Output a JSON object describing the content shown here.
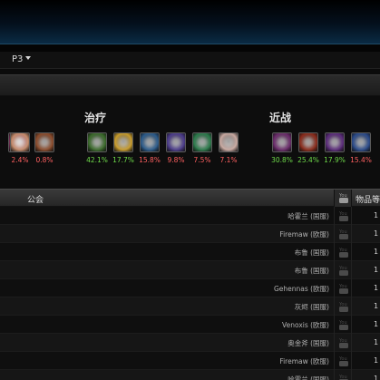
{
  "phase": {
    "label": "P3"
  },
  "groups": [
    {
      "title": "",
      "specs": [
        {
          "icon": "spec-icon-1",
          "pct": "",
          "color": "#ff6060",
          "bg": "#7a2a55"
        },
        {
          "icon": "spec-icon-2",
          "pct": "2.4%",
          "color": "#ff6060",
          "bg": "#c48a6a"
        },
        {
          "icon": "spec-icon-3",
          "pct": "0.8%",
          "color": "#ff6060",
          "bg": "#8a4a2a"
        }
      ]
    },
    {
      "title": "治疗",
      "specs": [
        {
          "icon": "nature-heal-icon",
          "pct": "42.1%",
          "color": "#6fdc4a",
          "bg": "#3a6a2a"
        },
        {
          "icon": "holy-light-icon",
          "pct": "17.7%",
          "color": "#6fdc4a",
          "bg": "#c69a2a"
        },
        {
          "icon": "water-shield-icon",
          "pct": "15.8%",
          "color": "#ff6060",
          "bg": "#2a5a8a"
        },
        {
          "icon": "shadow-mend-icon",
          "pct": "9.8%",
          "color": "#ff6060",
          "bg": "#4a3a8a"
        },
        {
          "icon": "leaf-heal-icon",
          "pct": "7.5%",
          "color": "#ff6060",
          "bg": "#2a7a4a"
        },
        {
          "icon": "monk-heal-icon",
          "pct": "7.1%",
          "color": "#ff6060",
          "bg": "#c8a8a0"
        }
      ]
    },
    {
      "title": "近战",
      "specs": [
        {
          "icon": "demon-hunter-icon",
          "pct": "30.8%",
          "color": "#6fdc4a",
          "bg": "#6a2a6a"
        },
        {
          "icon": "fury-icon",
          "pct": "25.4%",
          "color": "#6fdc4a",
          "bg": "#8a2a1a"
        },
        {
          "icon": "assassin-icon",
          "pct": "17.9%",
          "color": "#6fdc4a",
          "bg": "#5a2a7a"
        },
        {
          "icon": "frost-dk-icon",
          "pct": "15.4%",
          "color": "#ff6060",
          "bg": "#2a4a8a"
        }
      ]
    }
  ],
  "table": {
    "headers": {
      "guild": "公会",
      "item_level": "物品等"
    },
    "rows": [
      {
        "guild": "哈霍兰 (国服)",
        "ilvl": "1"
      },
      {
        "guild": "Firemaw (欧服)",
        "ilvl": "1"
      },
      {
        "guild": "布鲁 (国服)",
        "ilvl": "1"
      },
      {
        "guild": "布鲁 (国服)",
        "ilvl": "1"
      },
      {
        "guild": "Gehennas (欧服)",
        "ilvl": "1"
      },
      {
        "guild": "灰烬 (国服)",
        "ilvl": "1"
      },
      {
        "guild": "Venoxis (欧服)",
        "ilvl": "1"
      },
      {
        "guild": "奥金斧 (国服)",
        "ilvl": "1"
      },
      {
        "guild": "Firemaw (欧服)",
        "ilvl": "1"
      },
      {
        "guild": "哈霍兰 (国服)",
        "ilvl": "1"
      }
    ]
  }
}
